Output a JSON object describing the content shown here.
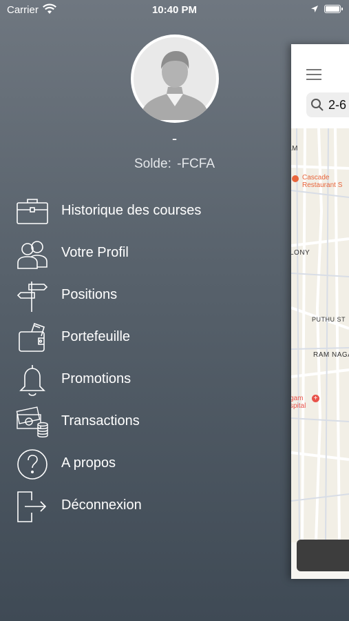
{
  "status_bar": {
    "carrier": "Carrier",
    "time": "10:40 PM"
  },
  "profile": {
    "name": "-",
    "balance_label": "Solde:",
    "balance_value": "-FCFA"
  },
  "menu": {
    "items": [
      {
        "label": "Historique des courses",
        "icon": "briefcase-icon"
      },
      {
        "label": "Votre Profil",
        "icon": "users-icon"
      },
      {
        "label": "Positions",
        "icon": "signpost-icon"
      },
      {
        "label": "Portefeuille",
        "icon": "wallet-icon"
      },
      {
        "label": "Promotions",
        "icon": "bell-icon"
      },
      {
        "label": "Transactions",
        "icon": "money-icon"
      },
      {
        "label": "A propos",
        "icon": "help-icon"
      },
      {
        "label": "Déconnexion",
        "icon": "logout-icon"
      }
    ]
  },
  "main_panel": {
    "search_text": "2-6",
    "map_labels": [
      "AM",
      "LONY",
      "PUTHU ST",
      "RAM NAGA"
    ],
    "pois": [
      {
        "name": "Cascade\nRestaurant S",
        "color": "#e8653b"
      },
      {
        "name": "gam\nspital",
        "color": "#e8534b"
      }
    ]
  }
}
